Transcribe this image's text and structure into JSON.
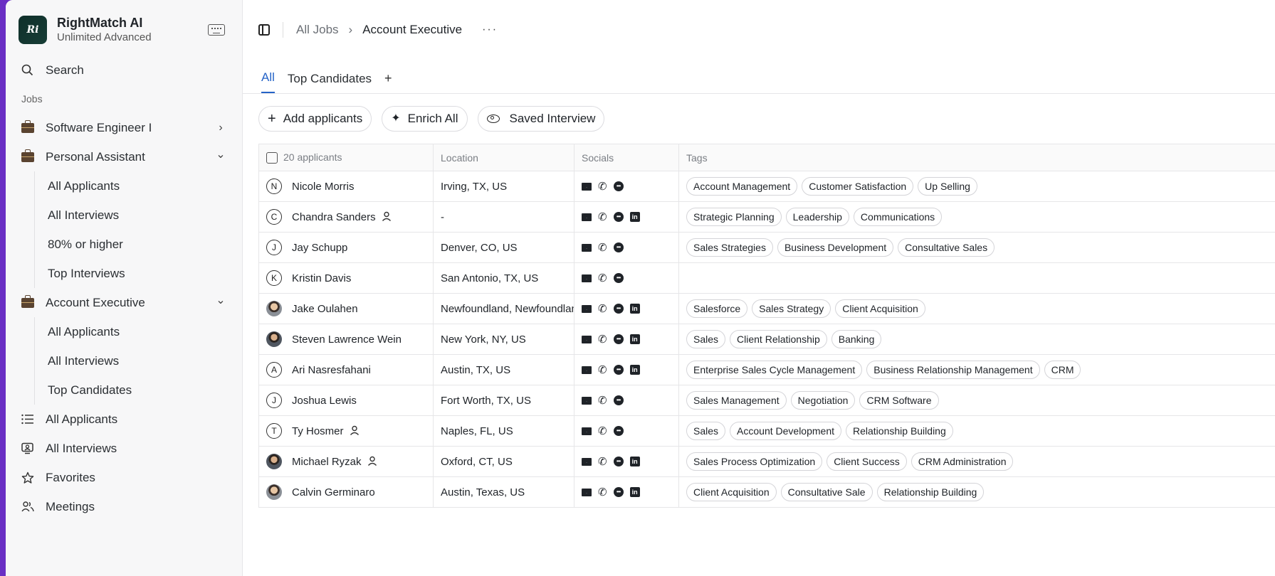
{
  "brand": {
    "name": "RightMatch AI",
    "plan": "Unlimited Advanced",
    "logo_text": "Ri"
  },
  "sidebar": {
    "search_label": "Search",
    "jobs_section": "Jobs",
    "jobs": [
      {
        "label": "Software Engineer I",
        "expanded": false,
        "children": []
      },
      {
        "label": "Personal Assistant",
        "expanded": true,
        "children": [
          "All Applicants",
          "All Interviews",
          "80% or higher",
          "Top Interviews"
        ]
      },
      {
        "label": "Account Executive",
        "expanded": true,
        "children": [
          "All Applicants",
          "All Interviews",
          "Top Candidates"
        ]
      }
    ],
    "bottom": [
      {
        "label": "All Applicants",
        "icon": "list-icon"
      },
      {
        "label": "All Interviews",
        "icon": "interview-icon"
      },
      {
        "label": "Favorites",
        "icon": "star-icon"
      },
      {
        "label": "Meetings",
        "icon": "people-icon"
      }
    ]
  },
  "breadcrumb": {
    "parent": "All Jobs",
    "current": "Account Executive",
    "more": "···"
  },
  "tabs": {
    "items": [
      "All",
      "Top Candidates"
    ],
    "active": "All",
    "add": "+"
  },
  "actions": {
    "add": "Add applicants",
    "enrich": "Enrich All",
    "saved": "Saved Interview"
  },
  "table": {
    "headers": {
      "name": "20 applicants",
      "location": "Location",
      "socials": "Socials",
      "tags": "Tags"
    },
    "rows": [
      {
        "initial": "N",
        "photo": false,
        "name": "Nicole Morris",
        "person": false,
        "location": "Irving, TX, US",
        "linkedin": false,
        "tags": [
          "Account Management",
          "Customer Satisfaction",
          "Up Selling"
        ]
      },
      {
        "initial": "C",
        "photo": false,
        "name": "Chandra Sanders",
        "person": true,
        "location": "-",
        "linkedin": true,
        "tags": [
          "Strategic Planning",
          "Leadership",
          "Communications"
        ]
      },
      {
        "initial": "J",
        "photo": false,
        "name": "Jay Schupp",
        "person": false,
        "location": "Denver, CO, US",
        "linkedin": false,
        "tags": [
          "Sales Strategies",
          "Business Development",
          "Consultative Sales"
        ]
      },
      {
        "initial": "K",
        "photo": false,
        "name": "Kristin Davis",
        "person": false,
        "location": "San Antonio, TX, US",
        "linkedin": false,
        "tags": []
      },
      {
        "initial": "",
        "photo": true,
        "name": "Jake Oulahen",
        "person": false,
        "location": "Newfoundland, Newfoundlan",
        "linkedin": true,
        "tags": [
          "Salesforce",
          "Sales Strategy",
          "Client Acquisition"
        ]
      },
      {
        "initial": "",
        "photo": true,
        "name": "Steven Lawrence Wein",
        "person": false,
        "location": "New York, NY, US",
        "linkedin": true,
        "tags": [
          "Sales",
          "Client Relationship",
          "Banking"
        ]
      },
      {
        "initial": "A",
        "photo": false,
        "name": "Ari Nasresfahani",
        "person": false,
        "location": "Austin, TX, US",
        "linkedin": true,
        "tags": [
          "Enterprise Sales Cycle Management",
          "Business Relationship Management",
          "CRM"
        ]
      },
      {
        "initial": "J",
        "photo": false,
        "name": "Joshua Lewis",
        "person": false,
        "location": "Fort Worth, TX, US",
        "linkedin": false,
        "tags": [
          "Sales Management",
          "Negotiation",
          "CRM Software"
        ]
      },
      {
        "initial": "T",
        "photo": false,
        "name": "Ty Hosmer",
        "person": true,
        "location": "Naples, FL, US",
        "linkedin": false,
        "tags": [
          "Sales",
          "Account Development",
          "Relationship Building"
        ]
      },
      {
        "initial": "",
        "photo": true,
        "name": "Michael Ryzak",
        "person": true,
        "location": "Oxford, CT, US",
        "linkedin": true,
        "tags": [
          "Sales Process Optimization",
          "Client Success",
          "CRM Administration"
        ]
      },
      {
        "initial": "",
        "photo": true,
        "name": "Calvin Germinaro",
        "person": false,
        "location": "Austin, Texas, US",
        "linkedin": true,
        "tags": [
          "Client Acquisition",
          "Consultative Sale",
          "Relationship Building"
        ]
      }
    ]
  },
  "colors": {
    "accent": "#2563c7",
    "frame": "#6a2fc4"
  }
}
